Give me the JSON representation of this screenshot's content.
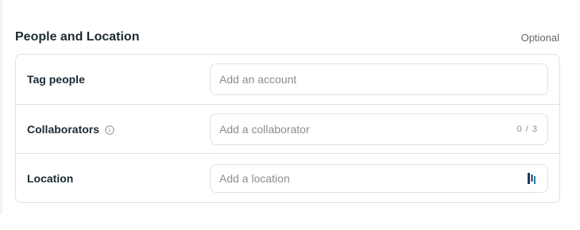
{
  "section": {
    "title": "People and Location",
    "optional_label": "Optional"
  },
  "rows": [
    {
      "label": "Tag people",
      "placeholder": "Add an account"
    },
    {
      "label": "Collaborators",
      "placeholder": "Add a collaborator",
      "counter": "0 / 3",
      "info_icon": "info-circle-icon"
    },
    {
      "label": "Location",
      "placeholder": "Add a location",
      "icon": "location-picker-icon"
    }
  ],
  "colors": {
    "border": "#dfe1e5",
    "placeholder": "#8a8d91",
    "label": "#1c2b33",
    "location_icon": "#1b3a57"
  }
}
